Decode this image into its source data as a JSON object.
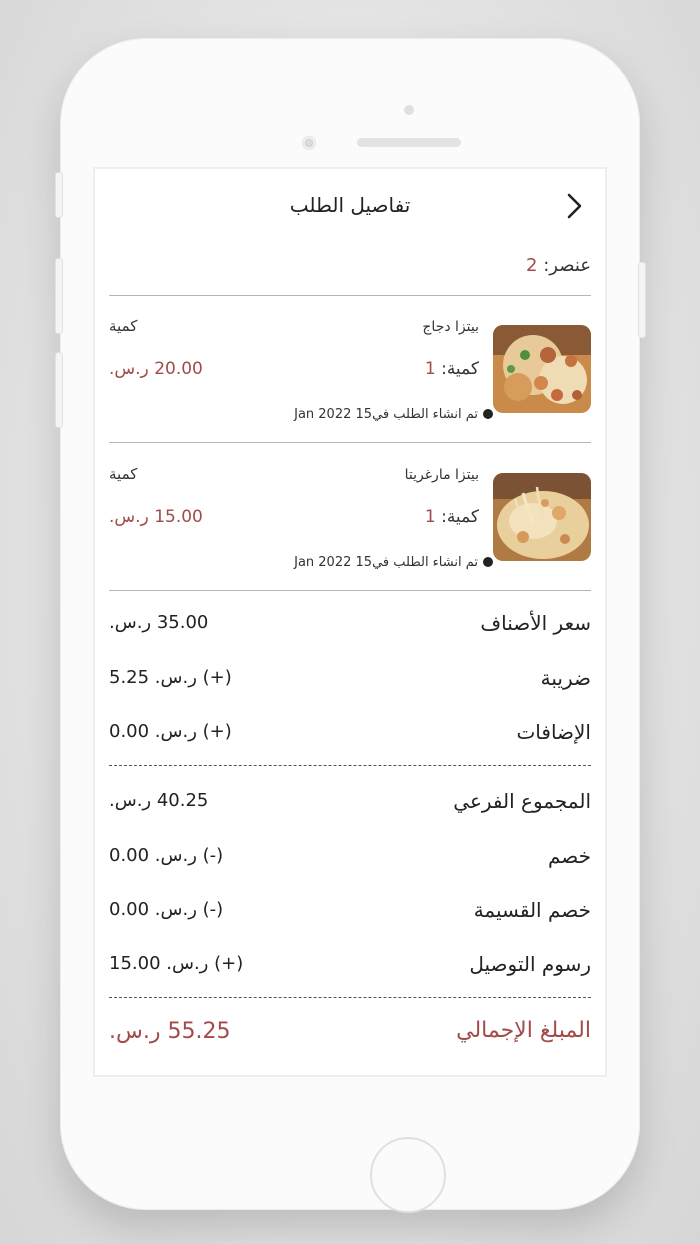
{
  "header": {
    "title": "تفاصيل الطلب",
    "back_icon": "chevron-right-icon"
  },
  "summary": {
    "items_label": "عنصر:",
    "items_count": "2"
  },
  "items": [
    {
      "name": "بيتزا دجاج",
      "qty_label": "كمية",
      "quantity_prefix": "كمية:",
      "quantity": "1",
      "price": "20.00 ر.س.",
      "created": "تم انشاء الطلب في15 Jan 2022"
    },
    {
      "name": "بيتزا مارغريتا",
      "qty_label": "كمية",
      "quantity_prefix": "كمية:",
      "quantity": "1",
      "price": "15.00 ر.س.",
      "created": "تم انشاء الطلب في15 Jan 2022"
    }
  ],
  "totals": {
    "items_price_label": "سعر الأصناف",
    "items_price_value": "35.00 ر.س.",
    "tax_label": "ضريبة",
    "tax_value": "(+) ر.س. 5.25",
    "addons_label": "الإضافات",
    "addons_value": "(+) ر.س. 0.00",
    "subtotal_label": "المجموع الفرعي",
    "subtotal_value": "40.25 ر.س.",
    "discount_label": "خصم",
    "discount_value": "(-) ر.س. 0.00",
    "coupon_label": "خصم القسيمة",
    "coupon_value": "(-) ر.س. 0.00",
    "delivery_label": "رسوم التوصيل",
    "delivery_value": "(+) ر.س. 15.00",
    "grand_total_label": "المبلغ الإجمالي",
    "grand_total_value": "55.25 ر.س."
  },
  "colors": {
    "accent": "#a34a4a"
  }
}
